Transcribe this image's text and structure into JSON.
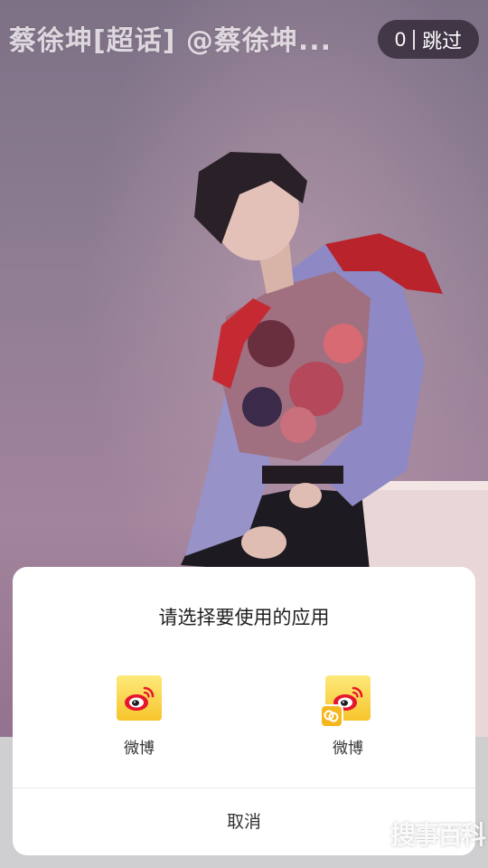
{
  "splash": {
    "title": "蔡徐坤[超话] @蔡徐坤...",
    "skip_count": "0",
    "skip_label": "跳过"
  },
  "chooser": {
    "title": "请选择要使用的应用",
    "options": [
      {
        "label": "微博",
        "icon": "weibo-icon"
      },
      {
        "label": "微博",
        "icon": "weibo-clone-icon"
      }
    ],
    "cancel_label": "取消"
  },
  "watermark": "搜事百科",
  "colors": {
    "weibo_yellow": "#f7c52b",
    "weibo_red": "#e6162d",
    "dialog_bg": "#ffffff"
  }
}
